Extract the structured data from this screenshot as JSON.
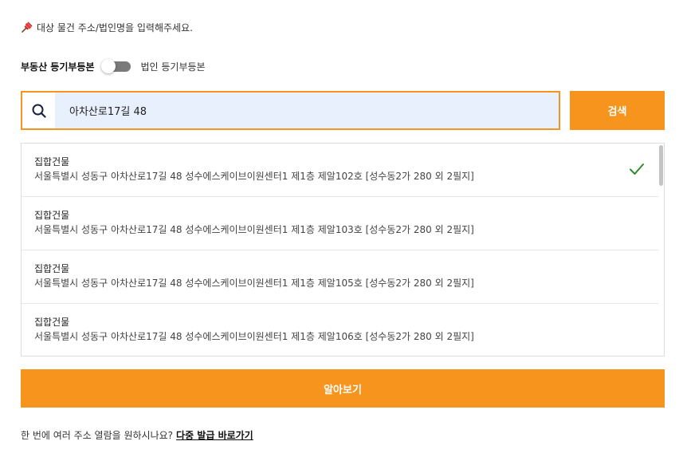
{
  "hint": {
    "icon": "pushpin-icon",
    "text": "대상 물건 주소/법인명을 입력해주세요."
  },
  "toggle": {
    "left_label": "부동산 등기부등본",
    "right_label": "법인 등기부등본",
    "state": "off"
  },
  "search": {
    "value": "아차산로17길 48",
    "icon": "search-icon",
    "button_label": "검색"
  },
  "results": [
    {
      "type": "집합건물",
      "address": "서울특별시 성동구 아차산로17길 48 성수에스케이브이원센터1 제1층 제알102호 [성수동2가 280 외 2필지]",
      "selected": true
    },
    {
      "type": "집합건물",
      "address": "서울특별시 성동구 아차산로17길 48 성수에스케이브이원센터1 제1층 제알103호 [성수동2가 280 외 2필지]",
      "selected": false
    },
    {
      "type": "집합건물",
      "address": "서울특별시 성동구 아차산로17길 48 성수에스케이브이원센터1 제1층 제알105호 [성수동2가 280 외 2필지]",
      "selected": false
    },
    {
      "type": "집합건물",
      "address": "서울특별시 성동구 아차산로17길 48 성수에스케이브이원센터1 제1층 제알106호 [성수동2가 280 외 2필지]",
      "selected": false
    }
  ],
  "go_button": {
    "label": "알아보기"
  },
  "footer": {
    "text": "한 번에 여러 주소 열람을 원하시나요?",
    "link": "다중 발급 바로가기"
  },
  "colors": {
    "accent": "#f7941d",
    "check": "#2e8b2e",
    "input_bg": "#e8f0fe"
  }
}
